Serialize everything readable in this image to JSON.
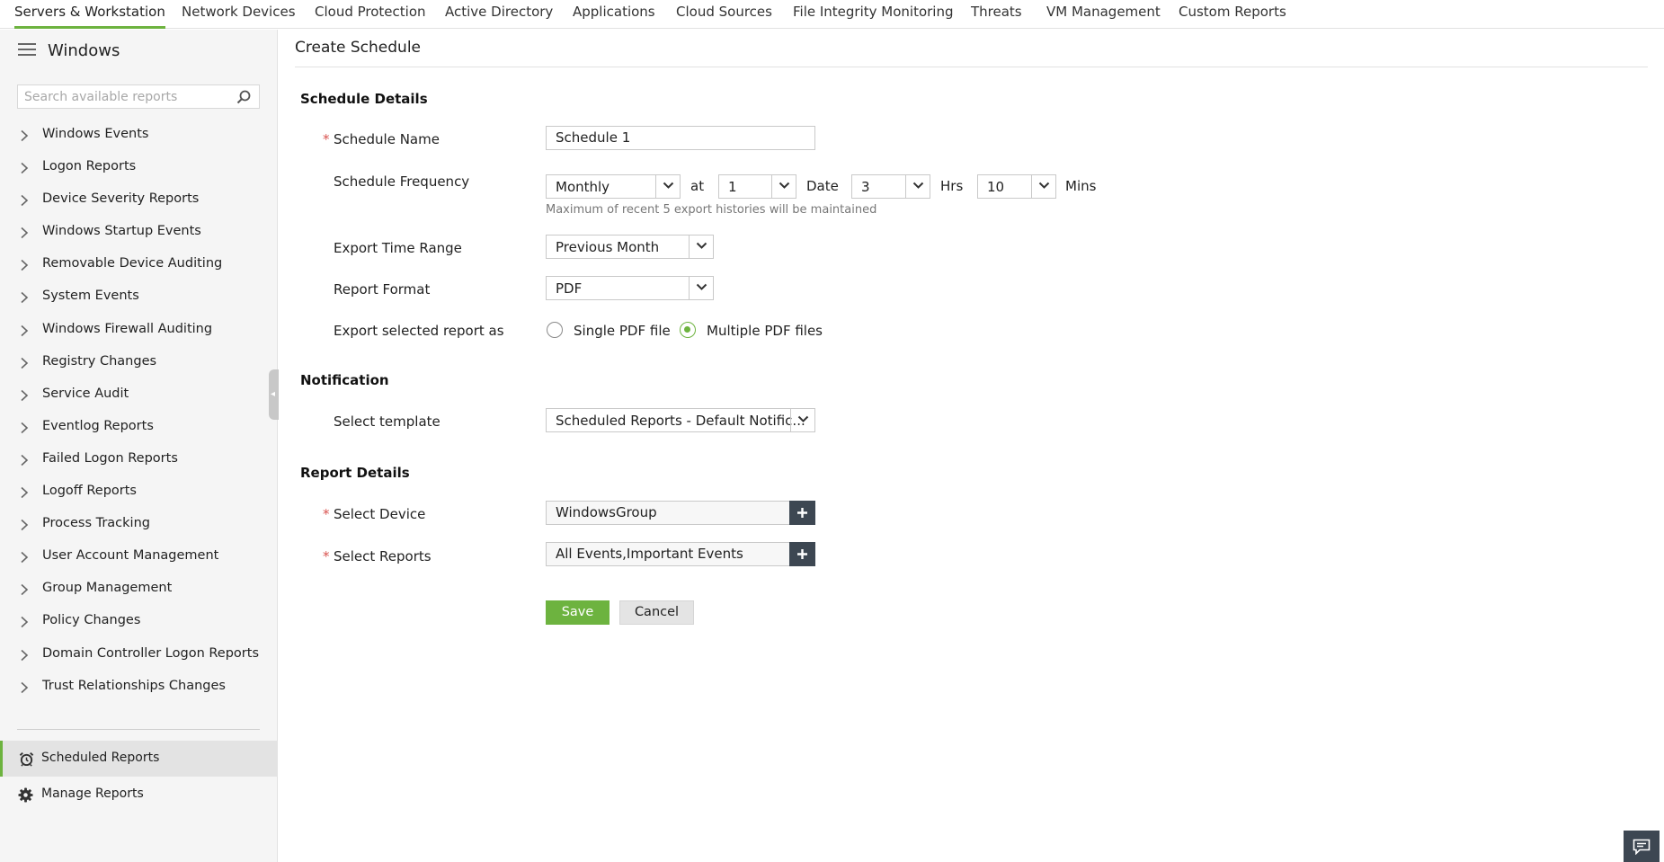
{
  "top_tabs": [
    "Servers & Workstation",
    "Network Devices",
    "Cloud Protection",
    "Active Directory",
    "Applications",
    "Cloud Sources",
    "File Integrity Monitoring",
    "Threats",
    "VM Management",
    "Custom Reports"
  ],
  "active_tab": "Servers & Workstation",
  "sidebar": {
    "title": "Windows",
    "search_placeholder": "Search available reports",
    "items": [
      "Windows Events",
      "Logon Reports",
      "Device Severity Reports",
      "Windows Startup Events",
      "Removable Device Auditing",
      "System Events",
      "Windows Firewall Auditing",
      "Registry Changes",
      "Service Audit",
      "Eventlog Reports",
      "Failed Logon Reports",
      "Logoff Reports",
      "Process Tracking",
      "User Account Management",
      "Group Management",
      "Policy Changes",
      "Domain Controller Logon Reports",
      "Trust Relationships Changes"
    ],
    "scheduled_reports": "Scheduled Reports",
    "manage_reports": "Manage Reports"
  },
  "main": {
    "page_title": "Create Schedule",
    "schedule_details": {
      "heading": "Schedule Details",
      "name_label": "Schedule Name",
      "name_value": "Schedule 1",
      "frequency_label": "Schedule Frequency",
      "frequency_value": "Monthly",
      "at_label": "at",
      "at_value": "1",
      "date_label": "Date",
      "hrs_value": "3",
      "hrs_label": "Hrs",
      "mins_value": "10",
      "mins_label": "Mins",
      "hint": "Maximum of recent 5 export histories will be maintained",
      "time_range_label": "Export Time Range",
      "time_range_value": "Previous Month",
      "format_label": "Report Format",
      "format_value": "PDF",
      "export_as_label": "Export selected report as",
      "export_option_single": "Single PDF file",
      "export_option_multiple": "Multiple PDF files",
      "export_selected": "Multiple PDF files"
    },
    "notification": {
      "heading": "Notification",
      "template_label": "Select template",
      "template_value": "Scheduled Reports - Default Notific..."
    },
    "report_details": {
      "heading": "Report Details",
      "device_label": "Select Device",
      "device_value": "WindowsGroup",
      "reports_label": "Select Reports",
      "reports_value": "All Events,Important Events"
    },
    "required_mark": "*",
    "save_label": "Save",
    "cancel_label": "Cancel"
  },
  "colors": {
    "accent_green": "#6db33f",
    "dark_button": "#3d4752",
    "required_red": "#d9534f"
  },
  "icons": [
    "hamburger-menu-icon",
    "search-icon",
    "chevron-right-icon",
    "alarm-clock-icon",
    "gear-icon",
    "chevron-down-icon",
    "plus-icon",
    "chat-icon"
  ]
}
